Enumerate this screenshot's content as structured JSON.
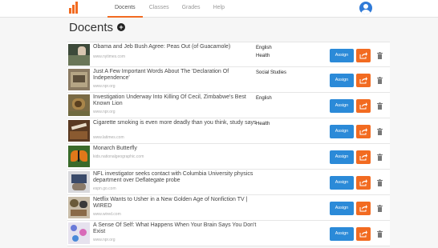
{
  "nav": {
    "tabs": [
      {
        "label": "Docents"
      },
      {
        "label": "Classes"
      },
      {
        "label": "Grades"
      },
      {
        "label": "Help"
      }
    ],
    "active_tab": "Docents"
  },
  "page": {
    "title": "Docents",
    "add_label": "+"
  },
  "docents": [
    {
      "title": "Obama and Jeb Bush Agree: Peas Out (of Guacamole)",
      "source": "www.nytimes.com",
      "tags": [
        "English",
        "Health"
      ],
      "assign_label": "Assign"
    },
    {
      "title": "Just A Few Important Words About The 'Declaration Of Independence'",
      "source": "www.npr.org",
      "tags": [
        "Social Studies"
      ],
      "assign_label": "Assign"
    },
    {
      "title": "Investigation Underway Into Killing Of Cecil, Zimbabwe's Best Known Lion",
      "source": "www.npr.org",
      "tags": [
        "English"
      ],
      "assign_label": "Assign"
    },
    {
      "title": "Cigarette smoking is even more deadly than you think, study says",
      "source": "www.latimes.com",
      "tags": [
        "Health"
      ],
      "assign_label": "Assign"
    },
    {
      "title": "Monarch Butterfly",
      "source": "kids.nationalgeographic.com",
      "tags": [],
      "assign_label": "Assign"
    },
    {
      "title": "NFL investigator seeks contact with Columbia University physics department over Deflategate probe",
      "source": "espn.go.com",
      "tags": [],
      "assign_label": "Assign"
    },
    {
      "title": "Netflix Wants to Usher in a New Golden Age of Nonfiction TV | WIRED",
      "source": "www.wired.com",
      "tags": [],
      "assign_label": "Assign"
    },
    {
      "title": "A Sense Of Self: What Happens When Your Brain Says You Don't Exist",
      "source": "www.npr.org",
      "tags": [],
      "assign_label": "Assign"
    }
  ],
  "colors": {
    "accent": "#f26b21",
    "assign": "#2b8ad8"
  },
  "icons": {
    "add": "plus-circle-icon",
    "share": "share-icon",
    "delete": "trash-icon",
    "avatar": "user-avatar-icon"
  }
}
